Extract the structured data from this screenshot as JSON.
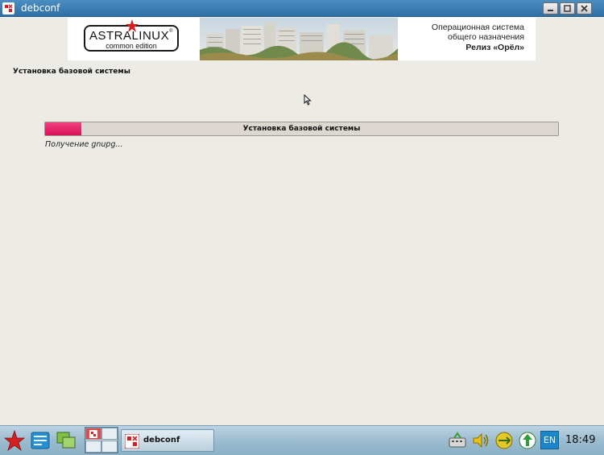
{
  "window": {
    "title": "debconf"
  },
  "banner": {
    "logo_main": "ASTRALINUX",
    "logo_registered": "®",
    "logo_sub": "common edition",
    "line1": "Операционная система",
    "line2": "общего назначения",
    "line3": "Релиз «Орёл»"
  },
  "installer": {
    "section_title": "Установка базовой системы",
    "progress_label": "Установка базовой системы",
    "progress_percent": 7,
    "status_text": "Получение gnupg..."
  },
  "taskbar": {
    "task_label": "debconf",
    "language": "EN",
    "clock": "18:49"
  },
  "colors": {
    "accent": "#d90f58",
    "titlebar": "#2f6fa5"
  }
}
